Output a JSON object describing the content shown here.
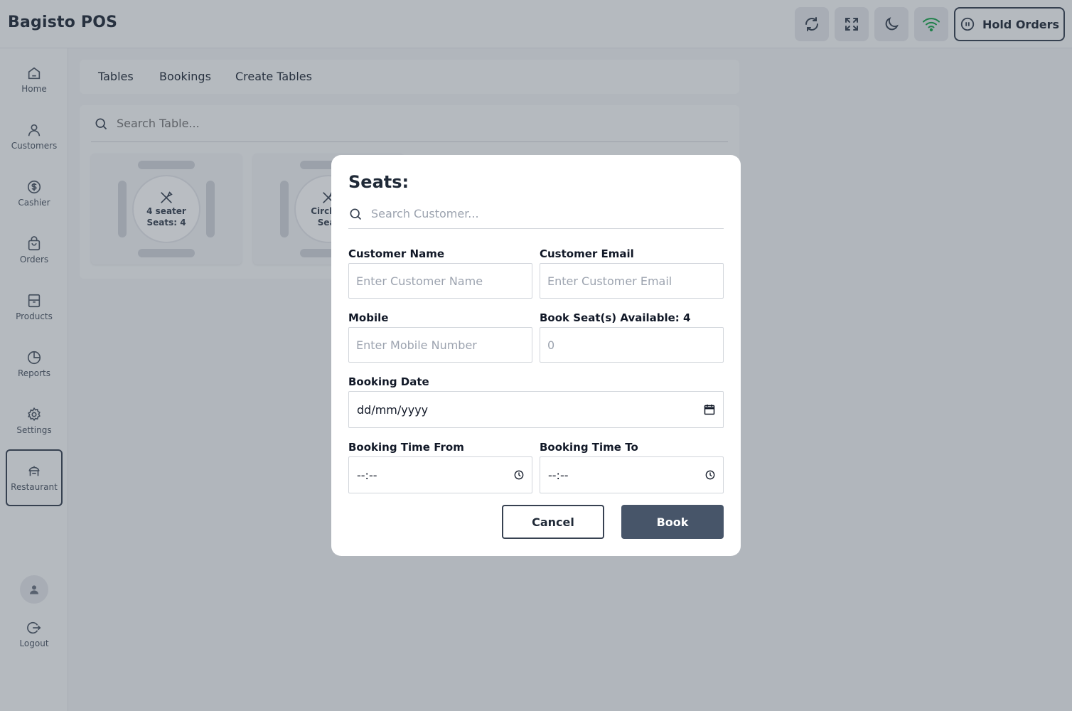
{
  "app": {
    "title": "Bagisto POS"
  },
  "header": {
    "icons": [
      "refresh-icon",
      "fullscreen-icon",
      "dark-mode-icon",
      "wifi-icon",
      "pause-icon"
    ],
    "hold_orders_label": "Hold Orders"
  },
  "sidebar": {
    "items": [
      {
        "label": "Home",
        "icon": "home-icon"
      },
      {
        "label": "Customers",
        "icon": "user-icon"
      },
      {
        "label": "Cashier",
        "icon": "dollar-icon"
      },
      {
        "label": "Orders",
        "icon": "bag-icon"
      },
      {
        "label": "Products",
        "icon": "box-icon"
      },
      {
        "label": "Reports",
        "icon": "pie-chart-icon"
      },
      {
        "label": "Settings",
        "icon": "gear-icon"
      },
      {
        "label": "Restaurant",
        "icon": "restaurant-icon",
        "active": true
      }
    ],
    "logout_label": "Logout"
  },
  "main": {
    "tabs": [
      {
        "label": "Tables"
      },
      {
        "label": "Bookings"
      },
      {
        "label": "Create Tables"
      }
    ],
    "search_placeholder": "Search Table...",
    "tables": [
      {
        "name": "4 seater",
        "seats": "Seats: 4"
      },
      {
        "name": "Circle s",
        "seats": "Seat"
      }
    ]
  },
  "modal": {
    "title": "Seats:",
    "customer_search_placeholder": "Search Customer...",
    "customer_name_label": "Customer Name",
    "customer_name_placeholder": "Enter Customer Name",
    "customer_email_label": "Customer Email",
    "customer_email_placeholder": "Enter Customer Email",
    "mobile_label": "Mobile",
    "mobile_placeholder": "Enter Mobile Number",
    "seats_label": "Book Seat(s) Available: 4",
    "seats_value": "0",
    "booking_date_label": "Booking Date",
    "booking_date_value": "dd/mm/yyyy",
    "time_from_label": "Booking Time From",
    "time_from_value": "--:--",
    "time_to_label": "Booking Time To",
    "time_to_value": "--:--",
    "cancel_label": "Cancel",
    "book_label": "Book"
  },
  "colors": {
    "primary": "#475569",
    "online": "#16a34a"
  }
}
